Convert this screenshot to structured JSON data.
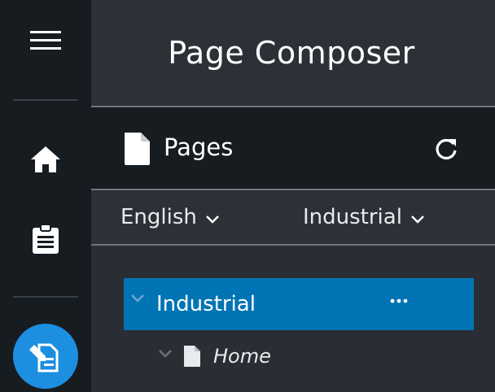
{
  "app": {
    "title": "Page Composer"
  },
  "rail": {
    "items": [
      {
        "icon": "menu-icon"
      },
      {
        "icon": "home-icon"
      },
      {
        "icon": "clipboard-icon"
      },
      {
        "icon": "page-edit-icon",
        "active": true
      }
    ],
    "active_color": "#1d8fe0"
  },
  "pages": {
    "title": "Pages",
    "refresh_icon": "refresh-icon"
  },
  "selectors": {
    "language": "English",
    "site": "Industrial"
  },
  "tree": {
    "root": {
      "label": "Industrial",
      "more": "···",
      "selected": true
    },
    "children": [
      {
        "label": "Home"
      }
    ]
  },
  "colors": {
    "selected_row": "#0074b4",
    "rail_bg": "#171c21",
    "panel_bg": "#2a2e34"
  }
}
